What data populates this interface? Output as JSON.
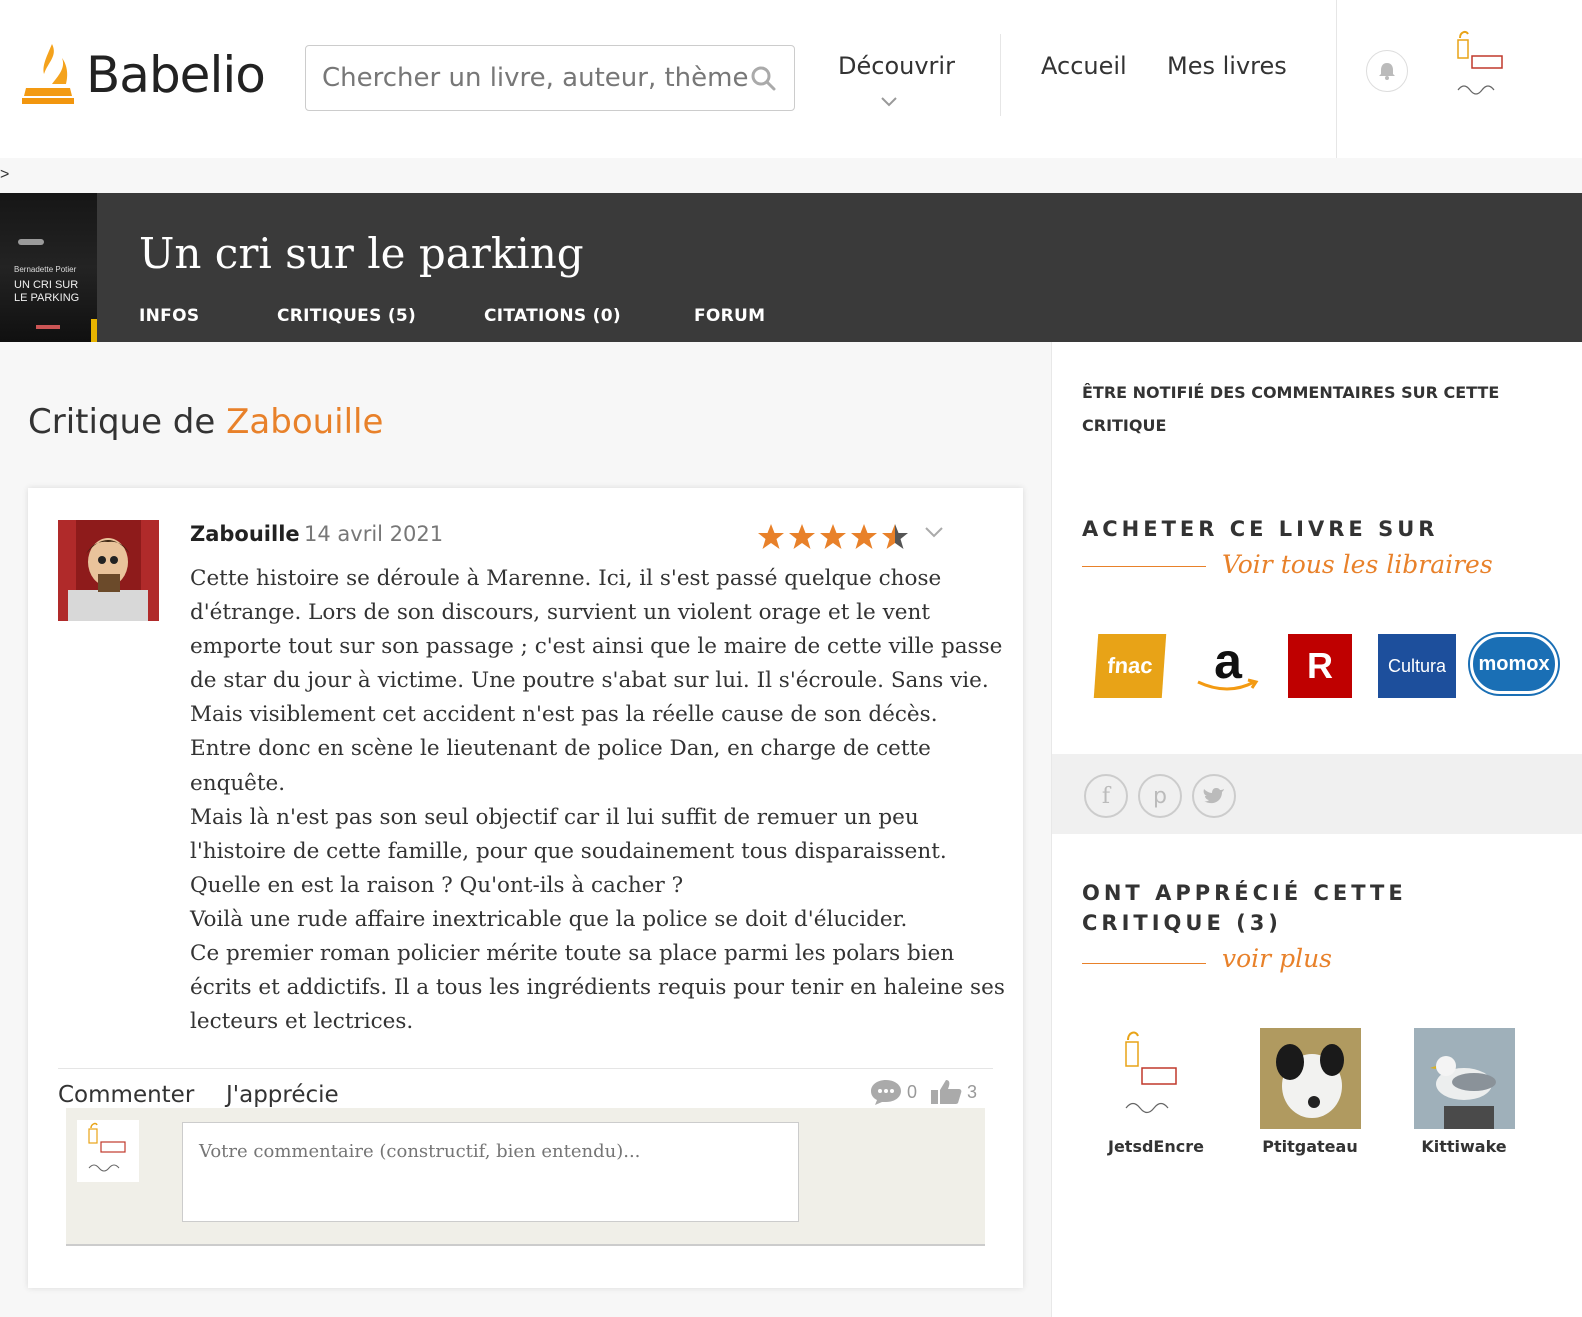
{
  "header": {
    "logo_text": "Babelio",
    "search_placeholder": "Chercher un livre, auteur, thème",
    "nav": {
      "discover": "Découvrir",
      "home": "Accueil",
      "my_books": "Mes livres"
    }
  },
  "breadcrumb": ">",
  "book": {
    "title": "Un cri sur le parking",
    "cover_author": "Bernadette Potier",
    "cover_title": "UN CRI SUR LE PARKING",
    "tabs": [
      "INFOS",
      "CRITIQUES (5)",
      "CITATIONS (0)",
      "FORUM"
    ]
  },
  "review": {
    "heading_prefix": "Critique de ",
    "heading_author": "Zabouille",
    "reviewer": "Zabouille",
    "date": "14 avril 2021",
    "rating": 4.5,
    "rating_max": 5,
    "lines": [
      "Cette histoire se déroule à Marenne. Ici, il s'est passé quelque chose",
      "d'étrange. Lors de son  discours, survient un violent orage et le vent",
      "emporte tout sur son passage ; c'est ainsi que le maire de cette ville passe",
      "de star du jour à victime. Une poutre s'abat sur lui. Il s'écroule. Sans vie.",
      "Mais visiblement cet accident n'est pas la réelle cause de son décès.",
      "Entre donc en scène le lieutenant de police Dan, en charge de cette",
      "enquête.",
      "Mais là n'est pas son seul objectif car il lui suffit de remuer un peu",
      "l'histoire de cette famille, pour que soudainement tous disparaissent.",
      "Quelle en est la raison ? Qu'ont-ils à cacher ?",
      "Voilà une rude affaire inextricable que la police se doit d'élucider.",
      "Ce premier roman policier mérite toute sa place parmi les polars bien",
      "écrits et addictifs. Il a tous les ingrédients requis pour tenir en haleine ses",
      "lecteurs et lectrices."
    ],
    "actions": {
      "comment": "Commenter",
      "like": "J'apprécie"
    },
    "comment_count": "0",
    "like_count": "3",
    "comment_placeholder": "Votre commentaire (constructif, bien entendu)..."
  },
  "sidebar": {
    "notify": "ÊTRE NOTIFIÉ DES COMMENTAIRES SUR CETTE CRITIQUE",
    "buy_title": "ACHETER CE LIVRE SUR",
    "buy_link": "Voir tous les libraires",
    "stores": [
      "fnac",
      "a",
      "R",
      "Cultura",
      "momox"
    ],
    "appreciated_title": "ONT APPRÉCIÉ CETTE CRITIQUE (3)",
    "appreciated_link": "voir plus",
    "likers": [
      "JetsdEncre",
      "Ptitgateau",
      "Kittiwake"
    ]
  },
  "colors": {
    "accent": "#e8812a",
    "banner": "#3a3a3a",
    "star": "#e8812a",
    "momox": "#1a6fb5",
    "cultura": "#1d4f9c",
    "fnac": "#e8a317",
    "rakuten": "#bf0000"
  },
  "icons": [
    "search-icon",
    "chevron-down-icon",
    "bell-icon",
    "star-icon",
    "comment-icon",
    "thumbs-up-icon",
    "facebook-icon",
    "pinterest-icon",
    "twitter-icon"
  ]
}
